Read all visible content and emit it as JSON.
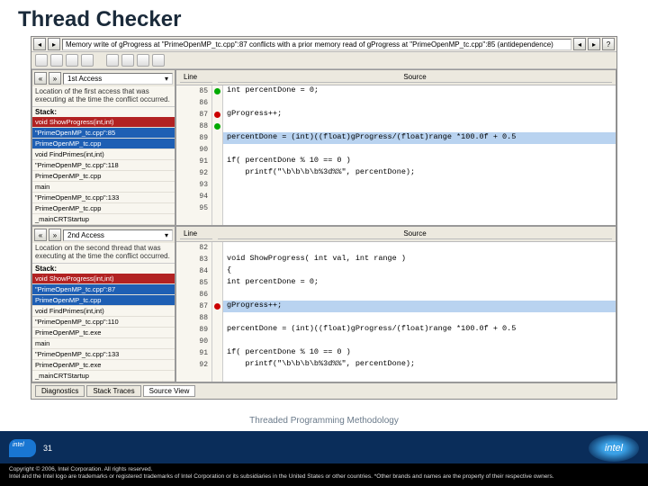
{
  "title": "Thread Checker",
  "status_msg": "Memory write of gProgress at \"PrimeOpenMP_tc.cpp\":87 conflicts with a prior memory read of gProgress at \"PrimeOpenMP_tc.cpp\":85 (antidependence)",
  "left": {
    "top": {
      "dropdown": "1st Access",
      "desc": "Location of the first access that was executing at the time the conflict occurred.",
      "stack_label": "Stack:",
      "items": [
        {
          "txt": "void ShowProgress(int,int)",
          "cls": "hl-red"
        },
        {
          "txt": "\"PrimeOpenMP_tc.cpp\":85",
          "cls": "hl-blue"
        },
        {
          "txt": "PrimeOpenMP_tc.cpp",
          "cls": "hl-blue"
        },
        {
          "txt": "void FindPrimes(int,int)",
          "cls": ""
        },
        {
          "txt": "\"PrimeOpenMP_tc.cpp\":118",
          "cls": ""
        },
        {
          "txt": "PrimeOpenMP_tc.cpp",
          "cls": ""
        },
        {
          "txt": "main",
          "cls": ""
        },
        {
          "txt": "\"PrimeOpenMP_tc.cpp\":133",
          "cls": ""
        },
        {
          "txt": "PrimeOpenMP_tc.cpp",
          "cls": ""
        },
        {
          "txt": "_mainCRTStartup",
          "cls": ""
        }
      ]
    },
    "bottom": {
      "dropdown": "2nd Access",
      "desc": "Location on the second thread that was executing at the time the conflict occurred.",
      "stack_label": "Stack:",
      "items": [
        {
          "txt": "void ShowProgress(int,int)",
          "cls": "hl-red"
        },
        {
          "txt": "\"PrimeOpenMP_tc.cpp\":87",
          "cls": "hl-blue"
        },
        {
          "txt": "PrimeOpenMP_tc.cpp",
          "cls": "hl-blue"
        },
        {
          "txt": "void FindPrimes(int,int)",
          "cls": ""
        },
        {
          "txt": "\"PrimeOpenMP_tc.cpp\":110",
          "cls": ""
        },
        {
          "txt": "PrimeOpenMP_tc.exe",
          "cls": ""
        },
        {
          "txt": "main",
          "cls": ""
        },
        {
          "txt": "\"PrimeOpenMP_tc.cpp\":133",
          "cls": ""
        },
        {
          "txt": "PrimeOpenMP_tc.exe",
          "cls": ""
        },
        {
          "txt": "_mainCRTStartup",
          "cls": ""
        }
      ]
    }
  },
  "right": {
    "line_header": "Line",
    "source_header": "Source",
    "top": {
      "lines": [
        "85",
        "86",
        "87",
        "88",
        "89",
        "90",
        "91",
        "92",
        "93",
        "94",
        "95"
      ],
      "marks": {
        "0": "g",
        "2": "r",
        "3": "g"
      },
      "src": [
        "int percentDone = 0;",
        "",
        "gProgress++;",
        "",
        "percentDone = (int)((float)gProgress/(float)range *100.0f + 0.5",
        "",
        "if( percentDone % 10 == 0 )",
        "    printf(\"\\b\\b\\b\\b%3d%%\", percentDone);",
        "",
        "",
        ""
      ],
      "hl_row": 4
    },
    "bottom": {
      "lines": [
        "82",
        "83",
        "84",
        "85",
        "86",
        "87",
        "88",
        "89",
        "90",
        "91",
        "92"
      ],
      "marks": {
        "5": "r"
      },
      "src": [
        "",
        "void ShowProgress( int val, int range )",
        "{",
        "int percentDone = 0;",
        "",
        "gProgress++;",
        "",
        "percentDone = (int)((float)gProgress/(float)range *100.0f + 0.5",
        "",
        "if( percentDone % 10 == 0 )",
        "    printf(\"\\b\\b\\b\\b%3d%%\", percentDone);"
      ],
      "hl_row": 5
    }
  },
  "tabs": [
    "Diagnostics",
    "Stack Traces",
    "Source View"
  ],
  "active_tab": 2,
  "footer": "Threaded Programming Methodology",
  "page": "31",
  "legal1": "Copyright © 2006, Intel Corporation. All rights reserved.",
  "legal2": "Intel and the Intel logo are trademarks or registered trademarks of Intel Corporation or its subsidiaries in the United States or other countries. *Other brands and names are the property of their respective owners.",
  "intel_label": "intel"
}
